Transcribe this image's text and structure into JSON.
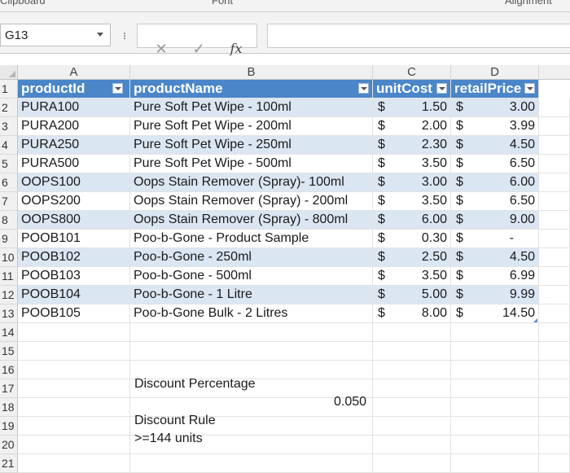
{
  "ribbon": {
    "left_label": "Clipboard",
    "mid_label": "Font",
    "right_label": "Alignment"
  },
  "formula_bar": {
    "name_box": "G13",
    "cancel_symbol": "✕",
    "enter_symbol": "✓",
    "fx_symbol": "fx",
    "formula": ""
  },
  "columns": [
    "A",
    "B",
    "C",
    "D"
  ],
  "row_numbers": [
    "1",
    "2",
    "3",
    "4",
    "5",
    "6",
    "7",
    "8",
    "9",
    "10",
    "11",
    "12",
    "13",
    "14",
    "15",
    "16",
    "17",
    "18",
    "19",
    "20",
    "21"
  ],
  "table": {
    "headers": {
      "A": "productId",
      "B": "productName",
      "C": "unitCost",
      "D": "retailPrice"
    },
    "currency_symbol": "$",
    "rows": [
      {
        "id": "PURA100",
        "name": "Pure Soft Pet Wipe - 100ml",
        "cost": "1.50",
        "price": "3.00"
      },
      {
        "id": "PURA200",
        "name": "Pure Soft Pet Wipe - 200ml",
        "cost": "2.00",
        "price": "3.99"
      },
      {
        "id": "PURA250",
        "name": "Pure Soft Pet Wipe - 250ml",
        "cost": "2.30",
        "price": "4.50"
      },
      {
        "id": "PURA500",
        "name": "Pure Soft Pet Wipe - 500ml",
        "cost": "3.50",
        "price": "6.50"
      },
      {
        "id": "OOPS100",
        "name": "Oops Stain Remover (Spray)- 100ml",
        "cost": "3.00",
        "price": "6.00"
      },
      {
        "id": "OOPS200",
        "name": "Oops Stain Remover (Spray) - 200ml",
        "cost": "3.50",
        "price": "6.50"
      },
      {
        "id": "OOPS800",
        "name": "Oops Stain Remover (Spray) - 800ml",
        "cost": "6.00",
        "price": "9.00"
      },
      {
        "id": "POOB101",
        "name": "Poo-b-Gone - Product Sample",
        "cost": "0.30",
        "price": "-"
      },
      {
        "id": "POOB102",
        "name": "Poo-b-Gone - 250ml",
        "cost": "2.50",
        "price": "4.50"
      },
      {
        "id": "POOB103",
        "name": "Poo-b-Gone - 500ml",
        "cost": "3.50",
        "price": "6.99"
      },
      {
        "id": "POOB104",
        "name": "Poo-b-Gone - 1 Litre",
        "cost": "5.00",
        "price": "9.99"
      },
      {
        "id": "POOB105",
        "name": "Poo-b-Gone Bulk - 2 Litres",
        "cost": "8.00",
        "price": "14.50"
      }
    ]
  },
  "extra": {
    "discount_label": "Discount Percentage",
    "discount_value": "0.050",
    "rule_label": "Discount Rule",
    "rule_value": ">=144 units"
  },
  "colors": {
    "header_blue": "#4a86c8",
    "band_blue": "#dbe6f3"
  }
}
